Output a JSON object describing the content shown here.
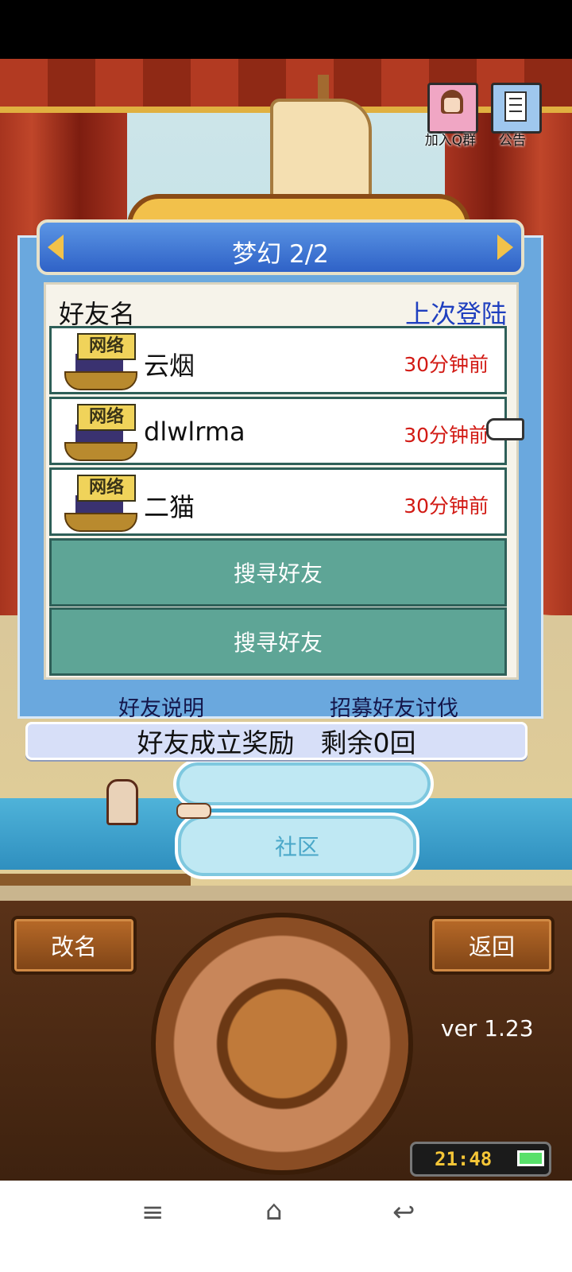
{
  "top_buttons": {
    "qq_group": {
      "label": "加入Q群",
      "icon": "girl-avatar-icon"
    },
    "notice": {
      "label": "公告",
      "icon": "document-icon"
    }
  },
  "friends_panel": {
    "header_title": "梦幻 2/2",
    "column_name": "好友名",
    "column_last_login": "上次登陆",
    "friends": [
      {
        "name": "云烟",
        "badge": "网络",
        "last_login": "30分钟前"
      },
      {
        "name": "dlwlrma",
        "badge": "网络",
        "last_login": "30分钟前"
      },
      {
        "name": "二猫",
        "badge": "网络",
        "last_login": "30分钟前"
      }
    ],
    "search_buttons": [
      "搜寻好友",
      "搜寻好友"
    ],
    "link_explain": "好友说明",
    "link_recruit": "招募好友讨伐"
  },
  "reward_bar": "好友成立奖励　剩余0回",
  "background_menu": {
    "button_community": "社区"
  },
  "console": {
    "rename_button": "改名",
    "back_button": "返回",
    "version": "ver 1.23",
    "clock": "21:48"
  },
  "colors": {
    "header_blue": "#3a6fd0",
    "time_red": "#d21a14",
    "search_green": "#5ea596",
    "console_brown": "#5a3218"
  }
}
